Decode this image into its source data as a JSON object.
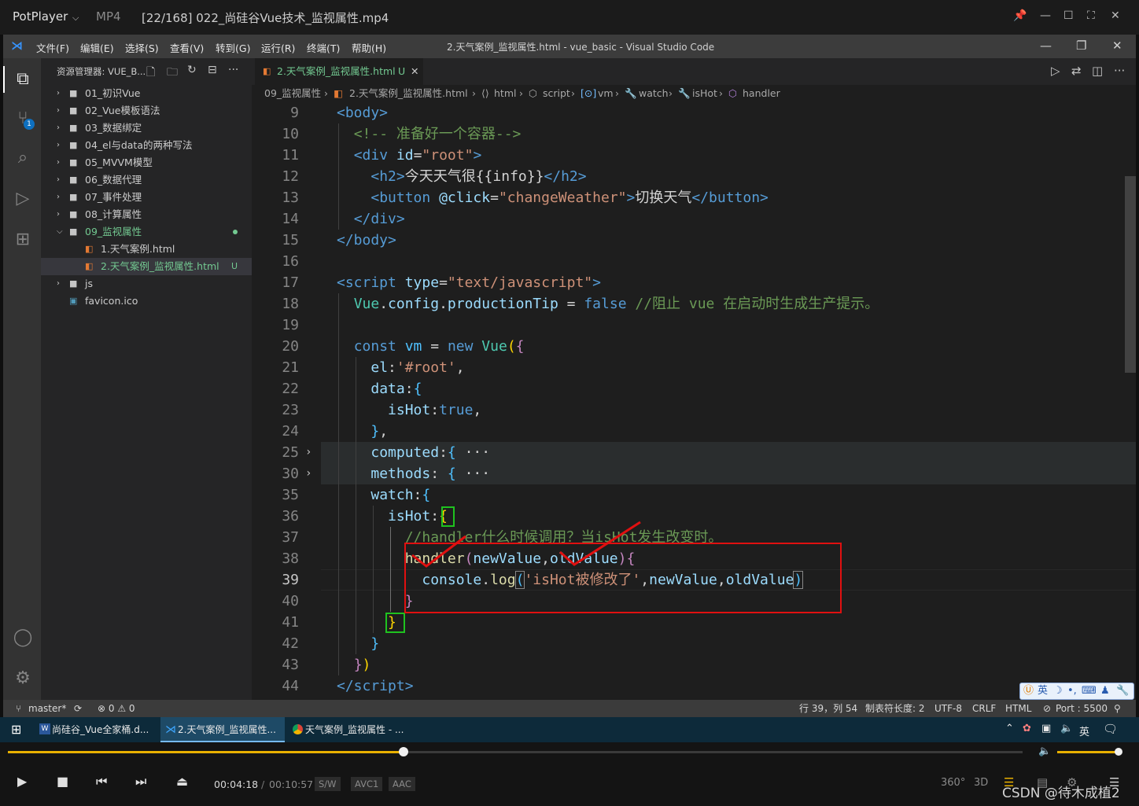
{
  "player": {
    "app": "PotPlayer",
    "format": "MP4",
    "file_title": "[22/168] 022_尚硅谷Vue技术_监视属性.mp4"
  },
  "vscode": {
    "menu": [
      "文件(F)",
      "编辑(E)",
      "选择(S)",
      "查看(V)",
      "转到(G)",
      "运行(R)",
      "终端(T)",
      "帮助(H)"
    ],
    "window_title": "2.天气案例_监视属性.html - vue_basic - Visual Studio Code",
    "explorer_title": "资源管理器: VUE_B...",
    "scm_badge": "1",
    "tree": [
      {
        "label": "01_初识Vue",
        "type": "folder"
      },
      {
        "label": "02_Vue模板语法",
        "type": "folder"
      },
      {
        "label": "03_数据绑定",
        "type": "folder"
      },
      {
        "label": "04_el与data的两种写法",
        "type": "folder"
      },
      {
        "label": "05_MVVM模型",
        "type": "folder"
      },
      {
        "label": "06_数据代理",
        "type": "folder"
      },
      {
        "label": "07_事件处理",
        "type": "folder"
      },
      {
        "label": "08_计算属性",
        "type": "folder"
      },
      {
        "label": "09_监视属性",
        "type": "folder-open"
      },
      {
        "label": "1.天气案例.html",
        "type": "html"
      },
      {
        "label": "2.天气案例_监视属性.html",
        "type": "html",
        "badge": "U"
      },
      {
        "label": "js",
        "type": "folder"
      },
      {
        "label": "favicon.ico",
        "type": "ico"
      }
    ],
    "tab": {
      "label": "2.天气案例_监视属性.html",
      "badge": "U"
    },
    "breadcrumbs": [
      "09_监视属性",
      "2.天气案例_监视属性.html",
      "html",
      "script",
      "vm",
      "watch",
      "isHot",
      "handler"
    ],
    "line_numbers": [
      "9",
      "10",
      "11",
      "12",
      "13",
      "14",
      "15",
      "16",
      "17",
      "18",
      "19",
      "20",
      "21",
      "22",
      "23",
      "24",
      "25",
      "30",
      "35",
      "36",
      "37",
      "38",
      "39",
      "40",
      "41",
      "42",
      "43",
      "44"
    ],
    "current_line": "39",
    "status": {
      "branch": "master*",
      "sync": "⟳",
      "problems": "⊗ 0 ⚠ 0",
      "position": "行 39，列 54",
      "tab_size": "制表符长度: 2",
      "encoding": "UTF-8",
      "eol": "CRLF",
      "language": "HTML",
      "port": "Port : 5500"
    }
  },
  "ime": {
    "lang": "英"
  },
  "taskbar": {
    "items": [
      "尚硅谷_Vue全家桶.d...",
      "2.天气案例_监视属性...",
      "天气案例_监视属性 - ..."
    ],
    "lang": "英"
  },
  "controls": {
    "time_current": "00:04:18",
    "time_sep": "/",
    "time_total": "00:10:57",
    "chips": [
      "S/W",
      "AVC1",
      "AAC"
    ],
    "labels": [
      "360°",
      "3D"
    ],
    "progress": 0.39,
    "volume": 0.95
  },
  "watermark": "CSDN @待木成植2"
}
